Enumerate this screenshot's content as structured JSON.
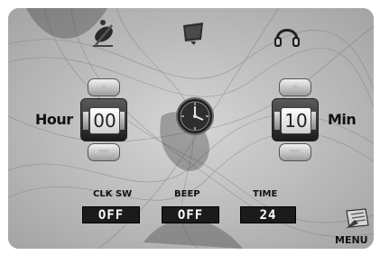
{
  "time_setting": {
    "hour_label": "Hour",
    "hour_value": "00",
    "min_label": "Min",
    "min_value": "10"
  },
  "options": [
    {
      "label": "CLK SW",
      "value": "OFF"
    },
    {
      "label": "BEEP",
      "value": "OFF"
    },
    {
      "label": "TIME",
      "value": "24"
    }
  ],
  "menu_label": "MENU",
  "icons": {
    "top_left": "satellite-dish-icon",
    "top_center": "display-icon",
    "top_right": "headphones-icon",
    "center": "clock-icon",
    "bottom_right": "menu-icon"
  }
}
